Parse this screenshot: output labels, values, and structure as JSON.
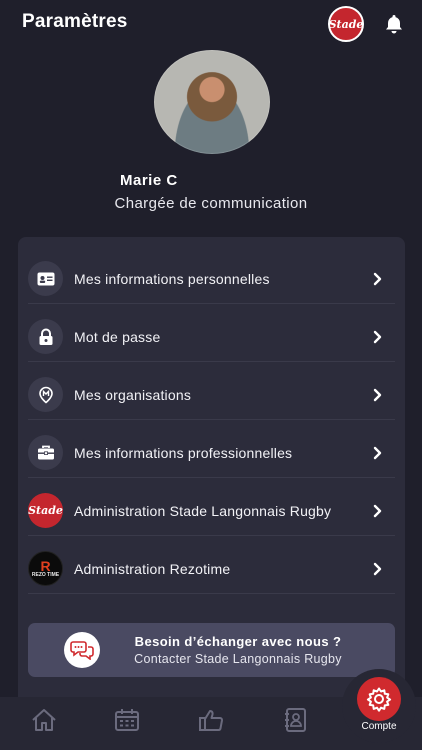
{
  "header": {
    "title": "Paramètres",
    "logo_text": "Stade"
  },
  "profile": {
    "name": "Marie C",
    "role": "Chargée de communication"
  },
  "menu": {
    "items": [
      {
        "label": "Mes informations personnelles",
        "icon": "id-card-icon"
      },
      {
        "label": "Mot de passe",
        "icon": "lock-icon"
      },
      {
        "label": "Mes organisations",
        "icon": "location-pin-icon"
      },
      {
        "label": "Mes informations professionnelles",
        "icon": "briefcase-icon"
      },
      {
        "label": "Administration Stade Langonnais Rugby",
        "icon": "stade-logo"
      },
      {
        "label": "Administration Rezotime",
        "icon": "rezotime-logo"
      }
    ]
  },
  "contact": {
    "title": "Besoin d’échanger avec nous ?",
    "subtitle": "Contacter Stade Langonnais Rugby"
  },
  "rezo_logo": {
    "mark": "R",
    "text": "REZO TIME"
  },
  "tabbar": {
    "active_label": "Compte",
    "tabs": [
      "home-icon",
      "calendar-icon",
      "thumbs-up-icon",
      "contacts-book-icon",
      "gear-icon"
    ]
  },
  "colors": {
    "background": "#1f1f2b",
    "card": "#2c2c3b",
    "accent": "#d02a2e",
    "contact_bg": "#4a4a62"
  }
}
